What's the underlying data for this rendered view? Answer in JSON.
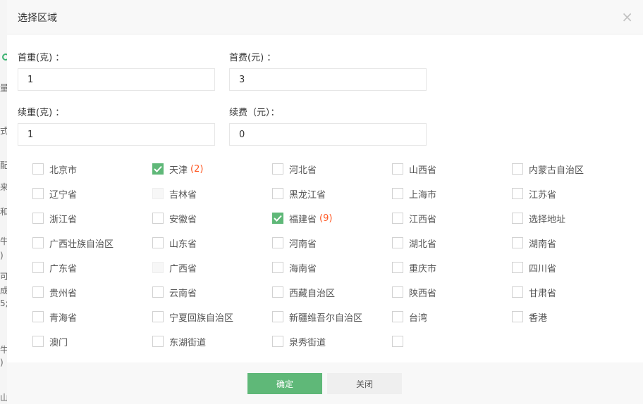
{
  "dialog": {
    "title": "选择区域",
    "close_symbol": "×"
  },
  "form": {
    "first_weight_label": "首重(克) ：",
    "first_weight_value": "1",
    "first_fee_label": "首费(元) ：",
    "first_fee_value": "3",
    "extra_weight_label": "续重(克) ：",
    "extra_weight_value": "1",
    "extra_fee_label": "续费（元）：",
    "extra_fee_value": "0"
  },
  "regions": [
    {
      "name": "北京市",
      "checked": false,
      "disabled": false,
      "count": ""
    },
    {
      "name": "天津",
      "checked": true,
      "disabled": false,
      "count": "(2)"
    },
    {
      "name": "河北省",
      "checked": false,
      "disabled": false,
      "count": ""
    },
    {
      "name": "山西省",
      "checked": false,
      "disabled": false,
      "count": ""
    },
    {
      "name": "内蒙古自治区",
      "checked": false,
      "disabled": false,
      "count": ""
    },
    {
      "name": "辽宁省",
      "checked": false,
      "disabled": false,
      "count": ""
    },
    {
      "name": "吉林省",
      "checked": false,
      "disabled": true,
      "count": ""
    },
    {
      "name": "黑龙江省",
      "checked": false,
      "disabled": false,
      "count": ""
    },
    {
      "name": "上海市",
      "checked": false,
      "disabled": false,
      "count": ""
    },
    {
      "name": "江苏省",
      "checked": false,
      "disabled": false,
      "count": ""
    },
    {
      "name": "浙江省",
      "checked": false,
      "disabled": false,
      "count": ""
    },
    {
      "name": "安徽省",
      "checked": false,
      "disabled": false,
      "count": ""
    },
    {
      "name": "福建省",
      "checked": true,
      "disabled": false,
      "count": "(9)"
    },
    {
      "name": "江西省",
      "checked": false,
      "disabled": false,
      "count": ""
    },
    {
      "name": "选择地址",
      "checked": false,
      "disabled": false,
      "count": ""
    },
    {
      "name": "广西壮族自治区",
      "checked": false,
      "disabled": false,
      "count": ""
    },
    {
      "name": "山东省",
      "checked": false,
      "disabled": false,
      "count": ""
    },
    {
      "name": "河南省",
      "checked": false,
      "disabled": false,
      "count": ""
    },
    {
      "name": "湖北省",
      "checked": false,
      "disabled": false,
      "count": ""
    },
    {
      "name": "湖南省",
      "checked": false,
      "disabled": false,
      "count": ""
    },
    {
      "name": "广东省",
      "checked": false,
      "disabled": false,
      "count": ""
    },
    {
      "name": "广西省",
      "checked": false,
      "disabled": true,
      "count": ""
    },
    {
      "name": "海南省",
      "checked": false,
      "disabled": false,
      "count": ""
    },
    {
      "name": "重庆市",
      "checked": false,
      "disabled": false,
      "count": ""
    },
    {
      "name": "四川省",
      "checked": false,
      "disabled": false,
      "count": ""
    },
    {
      "name": "贵州省",
      "checked": false,
      "disabled": false,
      "count": ""
    },
    {
      "name": "云南省",
      "checked": false,
      "disabled": false,
      "count": ""
    },
    {
      "name": "西藏自治区",
      "checked": false,
      "disabled": false,
      "count": ""
    },
    {
      "name": "陕西省",
      "checked": false,
      "disabled": false,
      "count": ""
    },
    {
      "name": "甘肃省",
      "checked": false,
      "disabled": false,
      "count": ""
    },
    {
      "name": "青海省",
      "checked": false,
      "disabled": false,
      "count": ""
    },
    {
      "name": "宁夏回族自治区",
      "checked": false,
      "disabled": false,
      "count": ""
    },
    {
      "name": "新疆维吾尔自治区",
      "checked": false,
      "disabled": false,
      "count": ""
    },
    {
      "name": "台湾",
      "checked": false,
      "disabled": false,
      "count": ""
    },
    {
      "name": "香港",
      "checked": false,
      "disabled": false,
      "count": ""
    },
    {
      "name": "澳门",
      "checked": false,
      "disabled": false,
      "count": ""
    },
    {
      "name": "东湖街道",
      "checked": false,
      "disabled": false,
      "count": ""
    },
    {
      "name": "泉秀街道",
      "checked": false,
      "disabled": false,
      "count": ""
    },
    {
      "name": "",
      "checked": false,
      "disabled": false,
      "count": ""
    }
  ],
  "footer": {
    "confirm_label": "确定",
    "close_label": "关闭"
  },
  "background_fragments": [
    "量",
    "式",
    "配",
    "来",
    "和",
    "牛",
    ")",
    "可",
    "成",
    "5;",
    "牛",
    ")",
    "山"
  ],
  "colors": {
    "accent_green": "#5fb878",
    "count_orange": "#ff5722"
  }
}
